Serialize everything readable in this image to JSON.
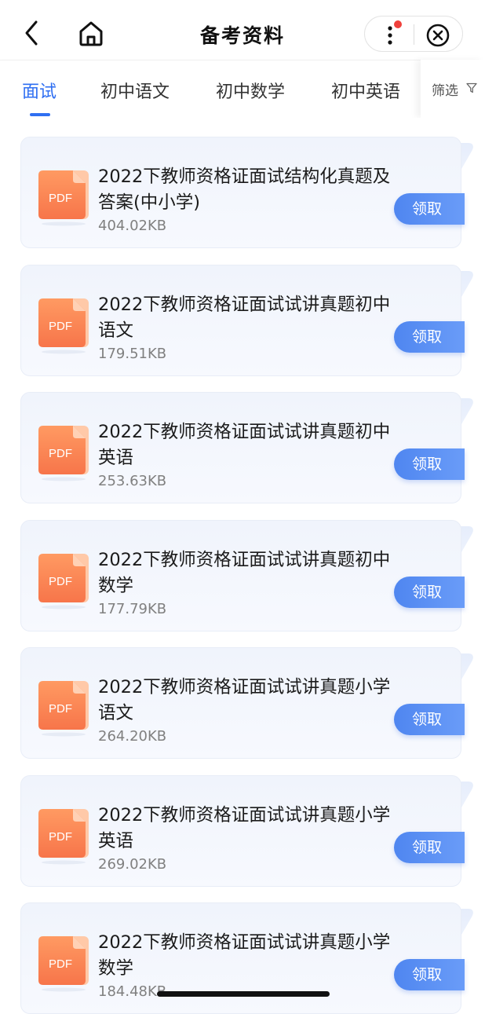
{
  "header": {
    "title": "备考资料",
    "back_icon": "chevron-left-icon",
    "home_icon": "home-icon",
    "more_icon": "more-vertical-icon",
    "close_icon": "close-circle-icon",
    "notification_dot_color": "#f0413c"
  },
  "tabs": {
    "items": [
      {
        "label": "面试",
        "active": true
      },
      {
        "label": "初中语文",
        "active": false
      },
      {
        "label": "初中数学",
        "active": false
      },
      {
        "label": "初中英语",
        "active": false
      }
    ],
    "filter_label": "筛选",
    "filter_icon": "filter-icon",
    "accent_color": "#2f6ff2"
  },
  "files": [
    {
      "title": "2022下教师资格证面试结构化真题及答案(中小学)",
      "size": "404.02KB",
      "action": "领取",
      "icon_label": "PDF"
    },
    {
      "title": "2022下教师资格证面试试讲真题初中语文",
      "size": "179.51KB",
      "action": "领取",
      "icon_label": "PDF"
    },
    {
      "title": "2022下教师资格证面试试讲真题初中英语",
      "size": "253.63KB",
      "action": "领取",
      "icon_label": "PDF"
    },
    {
      "title": "2022下教师资格证面试试讲真题初中数学",
      "size": "177.79KB",
      "action": "领取",
      "icon_label": "PDF"
    },
    {
      "title": "2022下教师资格证面试试讲真题小学语文",
      "size": "264.20KB",
      "action": "领取",
      "icon_label": "PDF"
    },
    {
      "title": "2022下教师资格证面试试讲真题小学英语",
      "size": "269.02KB",
      "action": "领取",
      "icon_label": "PDF"
    },
    {
      "title": "2022下教师资格证面试试讲真题小学数学",
      "size": "184.48KB",
      "action": "领取",
      "icon_label": "PDF"
    }
  ]
}
